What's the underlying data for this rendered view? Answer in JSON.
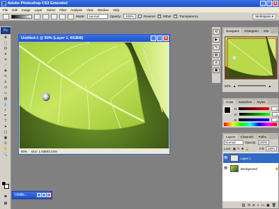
{
  "app": {
    "title": "Adobe Photoshop CS3 Extended",
    "logo_text": "Ps",
    "window_controls": [
      "_",
      "□",
      "×"
    ]
  },
  "menu": [
    "File",
    "Edit",
    "Image",
    "Layer",
    "Select",
    "Filter",
    "Analysis",
    "View",
    "Window",
    "Help"
  ],
  "options_bar": {
    "mode_label": "Mode:",
    "mode_value": "Normal",
    "opacity_label": "Opacity:",
    "opacity_value": "100%",
    "reverse_label": "Reverse",
    "dither_label": "Dither",
    "transparency_label": "Transparency",
    "workspace_label": "Workspace ▾"
  },
  "document": {
    "title": "Untitled-1 @ 50% (Layer 1, RGB/8)",
    "zoom": "50%",
    "doc_info": "Doc: 1.03M/3.21M"
  },
  "navigator": {
    "tabs": [
      "Navigator",
      "Histogram",
      "Info"
    ],
    "zoom": "50%"
  },
  "color_panel": {
    "tabs": [
      "Color",
      "Swatches",
      "Styles"
    ],
    "channels": [
      {
        "label": "R",
        "value": "0"
      },
      {
        "label": "G",
        "value": "0"
      },
      {
        "label": "B",
        "value": "0"
      }
    ]
  },
  "layers_panel": {
    "tabs": [
      "Layers",
      "Channels",
      "Paths"
    ],
    "blend_mode": "Normal",
    "opacity_label": "Opacity:",
    "opacity_value": "100%",
    "lock_label": "Lock:",
    "fill_label": "Fill:",
    "fill_value": "100%",
    "layers": [
      {
        "name": "Layer 1",
        "selected": true
      },
      {
        "name": "Background",
        "selected": false
      }
    ]
  },
  "minimized_window": {
    "title": "Untitle..."
  },
  "colors": {
    "chrome": "#d4d0c8",
    "title_blue": "#1d50c8",
    "workspace_gray": "#808080",
    "leaf_green": "#b5d94a",
    "selection_blue": "#316ac5"
  }
}
